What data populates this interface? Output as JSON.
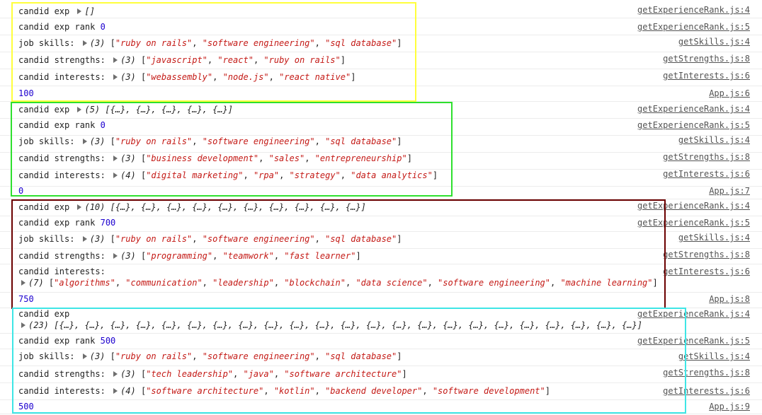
{
  "colors": {
    "number": "#1c00cf",
    "string": "#c41a16",
    "box1": "#ffff3c",
    "box2": "#2ee02e",
    "box3": "#6b0000",
    "box4": "#3ee6e6"
  },
  "entries": [
    {
      "label": "candid exp",
      "preview": "[]",
      "source": "getExperienceRank.js:4"
    },
    {
      "label": "candid exp rank",
      "value": "0",
      "source": "getExperienceRank.js:5"
    },
    {
      "label": "job skills:",
      "count": "(3)",
      "items": [
        "\"ruby on rails\"",
        "\"software engineering\"",
        "\"sql database\""
      ],
      "source": "getSkills.js:4"
    },
    {
      "label": "candid strengths:",
      "count": "(3)",
      "items": [
        "\"javascript\"",
        "\"react\"",
        "\"ruby on rails\""
      ],
      "source": "getStrengths.js:8"
    },
    {
      "label": "candid interests:",
      "count": "(3)",
      "items": [
        "\"webassembly\"",
        "\"node.js\"",
        "\"react native\""
      ],
      "source": "getInterests.js:6"
    },
    {
      "value": "100",
      "source": "App.js:6"
    },
    {
      "label": "candid exp",
      "preview": "(5) [{…}, {…}, {…}, {…}, {…}]",
      "source": "getExperienceRank.js:4"
    },
    {
      "label": "candid exp rank",
      "value": "0",
      "source": "getExperienceRank.js:5"
    },
    {
      "label": "job skills:",
      "count": "(3)",
      "items": [
        "\"ruby on rails\"",
        "\"software engineering\"",
        "\"sql database\""
      ],
      "source": "getSkills.js:4"
    },
    {
      "label": "candid strengths:",
      "count": "(3)",
      "items": [
        "\"business development\"",
        "\"sales\"",
        "\"entrepreneurship\""
      ],
      "source": "getStrengths.js:8"
    },
    {
      "label": "candid interests:",
      "count": "(4)",
      "items": [
        "\"digital marketing\"",
        "\"rpa\"",
        "\"strategy\"",
        "\"data analytics\""
      ],
      "source": "getInterests.js:6"
    },
    {
      "value": "0",
      "source": "App.js:7"
    },
    {
      "label": "candid exp",
      "preview": "(10) [{…}, {…}, {…}, {…}, {…}, {…}, {…}, {…}, {…}, {…}]",
      "source": "getExperienceRank.js:4"
    },
    {
      "label": "candid exp rank",
      "value": "700",
      "source": "getExperienceRank.js:5"
    },
    {
      "label": "job skills:",
      "count": "(3)",
      "items": [
        "\"ruby on rails\"",
        "\"software engineering\"",
        "\"sql database\""
      ],
      "source": "getSkills.js:4"
    },
    {
      "label": "candid strengths:",
      "count": "(3)",
      "items": [
        "\"programming\"",
        "\"teamwork\"",
        "\"fast learner\""
      ],
      "source": "getStrengths.js:8"
    },
    {
      "label": "candid interests:",
      "count": "(7)",
      "items": [
        "\"algorithms\"",
        "\"communication\"",
        "\"leadership\"",
        "\"blockchain\"",
        "\"data science\"",
        "\"software engineering\"",
        "\"machine learning\""
      ],
      "source": "getInterests.js:6"
    },
    {
      "value": "750",
      "source": "App.js:8"
    },
    {
      "label": "candid exp",
      "preview": "(23) [{…}, {…}, {…}, {…}, {…}, {…}, {…}, {…}, {…}, {…}, {…}, {…}, {…}, {…}, {…}, {…}, {…}, {…}, {…}, {…}, {…}, {…}, {…}]",
      "source": "getExperienceRank.js:4"
    },
    {
      "label": "candid exp rank",
      "value": "500",
      "source": "getExperienceRank.js:5"
    },
    {
      "label": "job skills:",
      "count": "(3)",
      "items": [
        "\"ruby on rails\"",
        "\"software engineering\"",
        "\"sql database\""
      ],
      "source": "getSkills.js:4"
    },
    {
      "label": "candid strengths:",
      "count": "(3)",
      "items": [
        "\"tech leadership\"",
        "\"java\"",
        "\"software architecture\""
      ],
      "source": "getStrengths.js:8"
    },
    {
      "label": "candid interests:",
      "count": "(4)",
      "items": [
        "\"software architecture\"",
        "\"kotlin\"",
        "\"backend developer\"",
        "\"software development\""
      ],
      "source": "getInterests.js:6"
    },
    {
      "value": "500",
      "source": "App.js:9"
    }
  ]
}
